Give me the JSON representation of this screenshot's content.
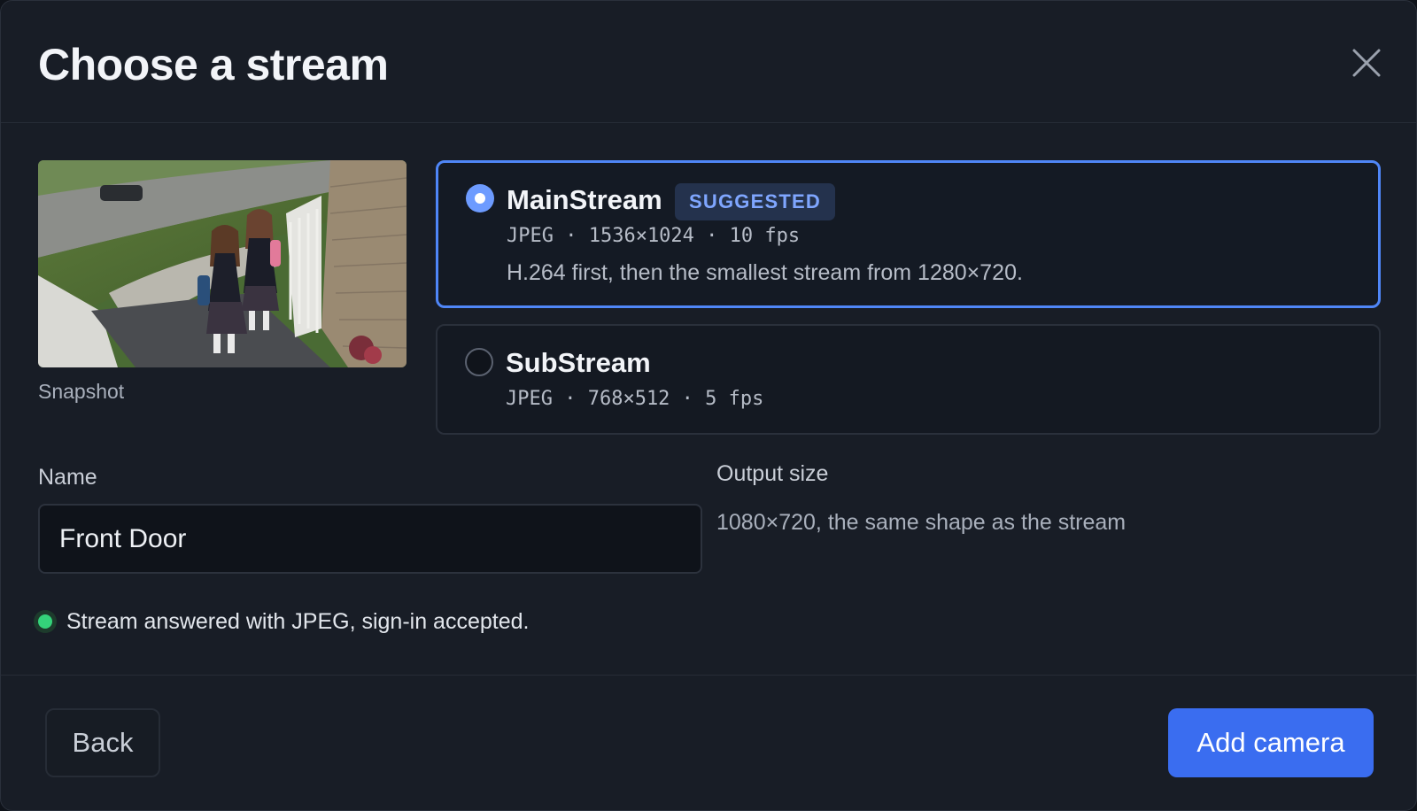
{
  "dialog": {
    "title": "Choose a stream",
    "close_icon": "close-icon"
  },
  "snapshot": {
    "label": "Snapshot"
  },
  "streams": [
    {
      "name": "MainStream",
      "badge": "SUGGESTED",
      "meta": "JPEG · 1536×1024 · 10 fps",
      "note": "H.264 first, then the smallest stream from 1280×720.",
      "selected": true
    },
    {
      "name": "SubStream",
      "meta": "JPEG · 768×512 · 5 fps",
      "selected": false
    }
  ],
  "name_field": {
    "label": "Name",
    "value": "Front Door"
  },
  "output": {
    "label": "Output size",
    "value": "1080×720, the same shape as the stream"
  },
  "status": {
    "text": "Stream answered with JPEG, sign-in accepted.",
    "color": "#34d27a"
  },
  "footer": {
    "back_label": "Back",
    "add_label": "Add camera"
  },
  "colors": {
    "accent": "#4f86f7",
    "primary_button": "#3a6df0",
    "background": "#181d26"
  }
}
